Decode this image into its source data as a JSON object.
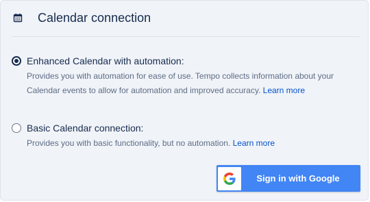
{
  "header": {
    "title": "Calendar connection",
    "icon": "calendar-icon"
  },
  "options": [
    {
      "label": "Enhanced Calendar with automation:",
      "selected": true,
      "description_line1": "Provides you with automation for ease of use. Tempo collects information about your",
      "description_line2": "Calendar events to allow for automation and improved accuracy.",
      "link": "Learn more"
    },
    {
      "label": "Basic Calendar connection:",
      "selected": false,
      "description": "Provides you with basic functionality, but no automation.",
      "link": "Learn more"
    }
  ],
  "google_button": {
    "label": "Sign in with Google",
    "icon": "google-g-icon",
    "color": "#4285f4"
  },
  "colors": {
    "text": "#172b4d",
    "subtext": "#5e6c84",
    "link": "#0052cc",
    "panel_bg": "#f0f3f8"
  }
}
